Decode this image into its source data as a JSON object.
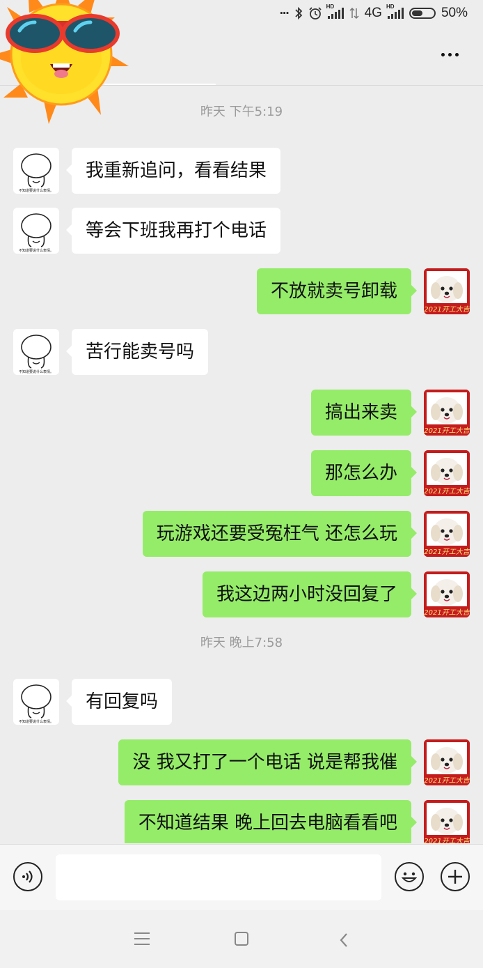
{
  "status_bar": {
    "dots": "...",
    "network_type": "4G",
    "signal_1_label": "HD",
    "signal_2_label": "HD",
    "battery": "50%",
    "battery_level": 0.5,
    "icons": [
      "bluetooth-icon",
      "alarm-icon",
      "signal-icon",
      "data-arrows-icon",
      "battery-icon"
    ]
  },
  "header": {
    "more_icon": "more-icon"
  },
  "messages": [
    {
      "type": "time",
      "text": "昨天 下午5:19"
    },
    {
      "type": "msg",
      "side": "left",
      "text": "我重新追问，看看结果"
    },
    {
      "type": "msg",
      "side": "left",
      "text": "等会下班我再打个电话"
    },
    {
      "type": "msg",
      "side": "right",
      "text": "不放就卖号卸载"
    },
    {
      "type": "msg",
      "side": "left",
      "text": "苦行能卖号吗"
    },
    {
      "type": "msg",
      "side": "right",
      "text": "搞出来卖"
    },
    {
      "type": "msg",
      "side": "right",
      "text": "那怎么办"
    },
    {
      "type": "msg",
      "side": "right",
      "text": "玩游戏还要受冤枉气 还怎么玩"
    },
    {
      "type": "msg",
      "side": "right",
      "text": "我这边两小时没回复了"
    },
    {
      "type": "time",
      "text": "昨天 晚上7:58"
    },
    {
      "type": "msg",
      "side": "left",
      "text": "有回复吗"
    },
    {
      "type": "msg",
      "side": "right",
      "text": "没 我又打了一个电话 说是帮我催"
    },
    {
      "type": "msg",
      "side": "right",
      "text": "不知道结果 晚上回去电脑看看吧"
    }
  ],
  "avatars": {
    "left_caption": "不知道要说什么表情。",
    "right_caption": "2021开工大吉"
  },
  "input_bar": {
    "text_value": "",
    "icons": [
      "voice-icon",
      "emoji-icon",
      "plus-icon"
    ]
  },
  "nav_bar": {
    "icons": [
      "menu-icon",
      "home-icon",
      "back-icon"
    ]
  },
  "colors": {
    "background": "#ededed",
    "my_bubble": "#95ec69",
    "their_bubble": "#ffffff",
    "timestamp": "#9a9a9a"
  }
}
